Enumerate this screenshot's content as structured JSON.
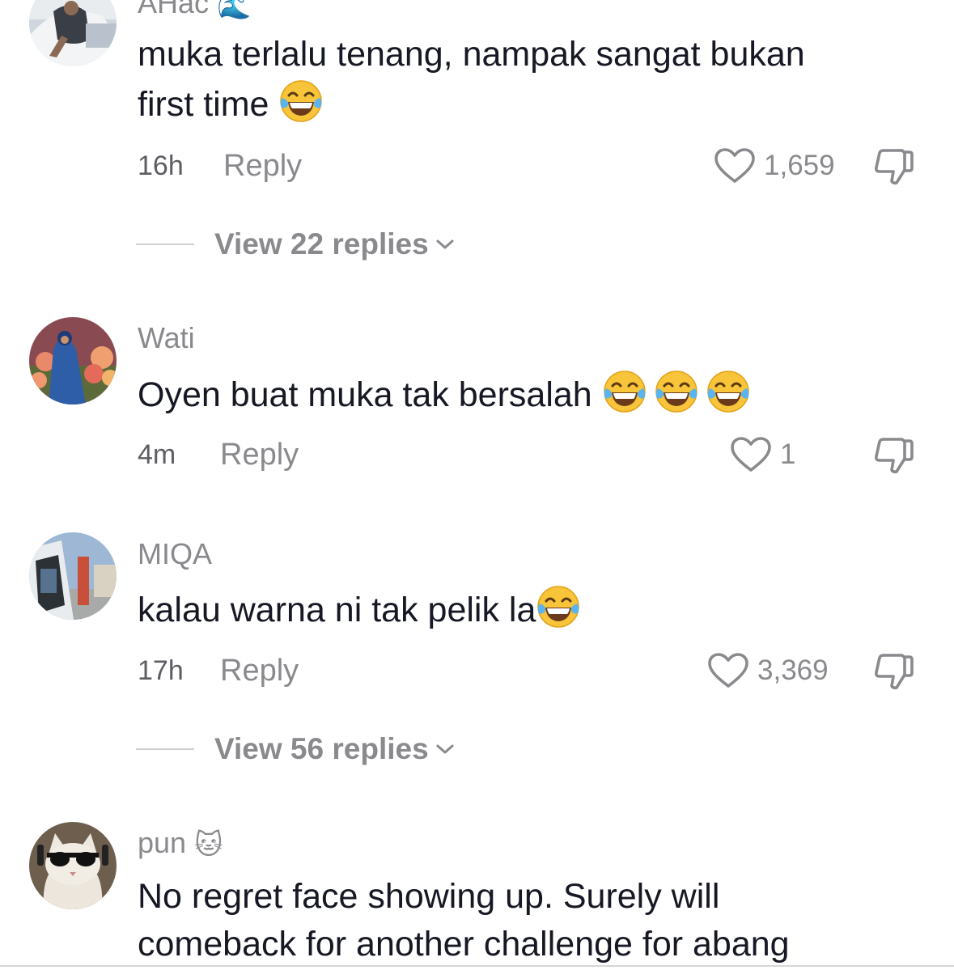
{
  "comments": [
    {
      "username": "AHac",
      "username_emoji": "🌊",
      "lines": [
        "muka terlalu tenang, nampak sangat bukan",
        "first time"
      ],
      "emoji_count": 1,
      "time": "16h",
      "reply_label": "Reply",
      "likes": "1,659",
      "view_replies": "View 22 replies"
    },
    {
      "username": "Wati",
      "lines": [
        "Oyen buat muka tak bersalah"
      ],
      "emoji_count": 3,
      "time": "4m",
      "reply_label": "Reply",
      "likes": "1"
    },
    {
      "username": "MIQA",
      "lines": [
        "kalau warna ni tak pelik la"
      ],
      "emoji_count": 1,
      "time": "17h",
      "reply_label": "Reply",
      "likes": "3,369",
      "view_replies": "View 56 replies"
    },
    {
      "username": "pun",
      "username_emoji": "🐱",
      "lines": [
        "No regret face showing up. Surely will",
        "comeback for another challenge for abang"
      ]
    }
  ],
  "icons": {
    "like": "heart-outline-icon",
    "dislike": "thumbs-down-icon",
    "expand": "chevron-down-icon",
    "emoji": "face-with-tears-of-joy"
  },
  "colors": {
    "text": "#161823",
    "secondary": "#8a8a8e",
    "emoji_yellow": "#f9c233"
  }
}
